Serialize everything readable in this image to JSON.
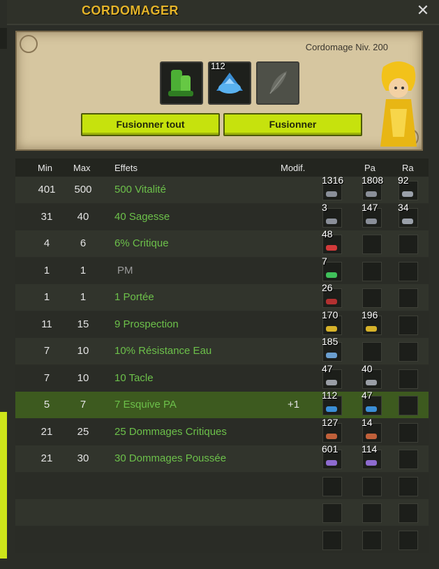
{
  "window": {
    "title": "CORDOMAGER",
    "close_symbol": "✕"
  },
  "panel": {
    "level_text": "Cordomage Niv. 200",
    "slot2_quantity": "112",
    "fuse_all_label": "Fusionner tout",
    "fuse_label": "Fusionner"
  },
  "table": {
    "headers": {
      "min": "Min",
      "max": "Max",
      "effects": "Effets",
      "modif": "Modif.",
      "pa": "Pa",
      "ra": "Ra"
    },
    "rows": [
      {
        "min": "401",
        "max": "500",
        "effect": "500 Vitalité",
        "modif": "",
        "r1": "1316",
        "r2": "1808",
        "r3": "92"
      },
      {
        "min": "31",
        "max": "40",
        "effect": "40 Sagesse",
        "modif": "",
        "r1": "3",
        "r2": "147",
        "r3": "34"
      },
      {
        "min": "4",
        "max": "6",
        "effect": "6% Critique",
        "modif": "",
        "r1": "48",
        "r2": "",
        "r3": ""
      },
      {
        "min": "1",
        "max": "1",
        "effect": "PM",
        "modif": "",
        "r1": "7",
        "r2": "",
        "r3": ""
      },
      {
        "min": "1",
        "max": "1",
        "effect": "1 Portée",
        "modif": "",
        "r1": "26",
        "r2": "",
        "r3": ""
      },
      {
        "min": "11",
        "max": "15",
        "effect": "9 Prospection",
        "modif": "",
        "r1": "170",
        "r2": "196",
        "r3": ""
      },
      {
        "min": "7",
        "max": "10",
        "effect": "10% Résistance Eau",
        "modif": "",
        "r1": "185",
        "r2": "",
        "r3": ""
      },
      {
        "min": "7",
        "max": "10",
        "effect": "10 Tacle",
        "modif": "",
        "r1": "47",
        "r2": "40",
        "r3": ""
      },
      {
        "min": "5",
        "max": "7",
        "effect": "7 Esquive PA",
        "modif": "+1",
        "r1": "112",
        "r2": "47",
        "r3": ""
      },
      {
        "min": "21",
        "max": "25",
        "effect": "25 Dommages Critiques",
        "modif": "",
        "r1": "127",
        "r2": "14",
        "r3": ""
      },
      {
        "min": "21",
        "max": "30",
        "effect": "30 Dommages Poussée",
        "modif": "",
        "r1": "601",
        "r2": "114",
        "r3": ""
      }
    ]
  },
  "colors": {
    "accent": "#c6e20d",
    "title": "#e4b42a",
    "effect_text": "#6cc04a",
    "highlight_row": "#3d5a1f"
  },
  "icons": [
    "close-icon",
    "item-icon",
    "rune-icon",
    "feather-icon",
    "character-portrait"
  ]
}
